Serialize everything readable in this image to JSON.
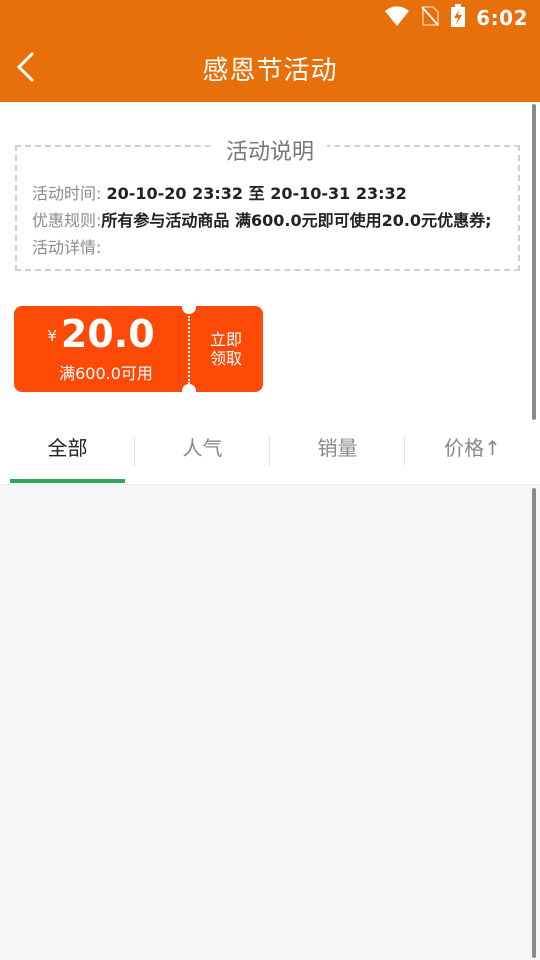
{
  "status": {
    "time": "6:02",
    "icons": [
      "wifi-icon",
      "no-sim-icon",
      "battery-charging-icon"
    ]
  },
  "header": {
    "title": "感恩节活动",
    "back_icon": "chevron-left-icon"
  },
  "description": {
    "title": "活动说明",
    "time_label": "活动时间: ",
    "time_value": "20-10-20 23:32 至 20-10-31 23:32",
    "rule_label": "优惠规则:",
    "rule_value": "所有参与活动商品 满600.0元即可使用20.0元优惠券;",
    "detail_label": "活动详情:",
    "detail_value": ""
  },
  "coupon": {
    "currency": "¥",
    "amount": "20.0",
    "condition": "满600.0可用",
    "claim_line1": "立即",
    "claim_line2": "领取"
  },
  "tabs": [
    {
      "label": "全部",
      "active": true
    },
    {
      "label": "人气",
      "active": false
    },
    {
      "label": "销量",
      "active": false
    },
    {
      "label": "价格↑",
      "active": false
    }
  ],
  "colors": {
    "primary": "#e8700b",
    "coupon": "#fe4a07",
    "tab_indicator": "#2fa75a"
  }
}
